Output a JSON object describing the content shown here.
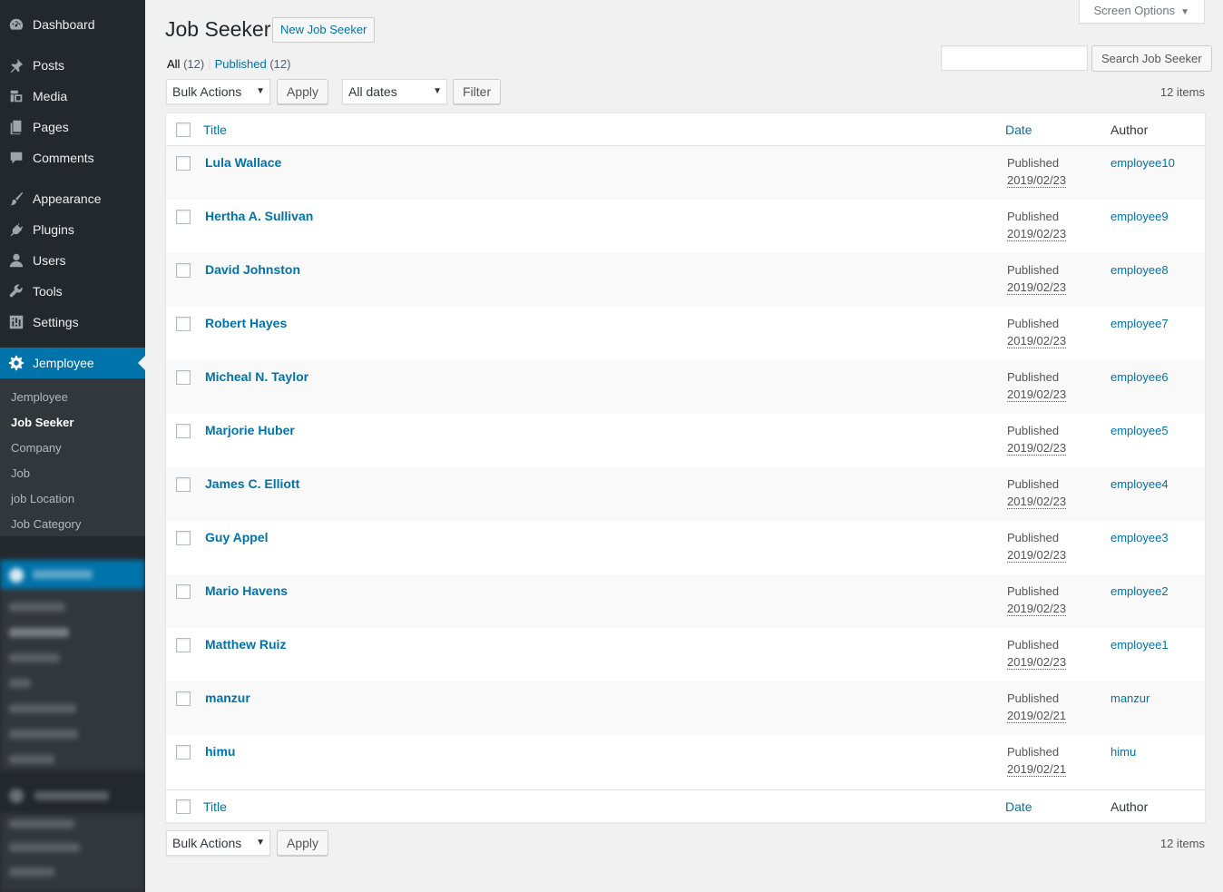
{
  "sidebar": {
    "menu": [
      {
        "label": "Dashboard",
        "icon": "dashboard-icon"
      },
      {
        "label": "Posts",
        "icon": "pin-icon"
      },
      {
        "label": "Media",
        "icon": "media-icon"
      },
      {
        "label": "Pages",
        "icon": "pages-icon"
      },
      {
        "label": "Comments",
        "icon": "comment-icon"
      },
      {
        "label": "Appearance",
        "icon": "brush-icon"
      },
      {
        "label": "Plugins",
        "icon": "plug-icon"
      },
      {
        "label": "Users",
        "icon": "user-icon"
      },
      {
        "label": "Tools",
        "icon": "wrench-icon"
      },
      {
        "label": "Settings",
        "icon": "settings-icon"
      },
      {
        "label": "Jemployee",
        "icon": "gear-icon"
      }
    ],
    "submenu": [
      "Jemployee",
      "Job Seeker",
      "Company",
      "Job",
      "job Location",
      "Job Category"
    ]
  },
  "header": {
    "screen_options": "Screen Options",
    "title": "Job Seeker",
    "new_button": "New Job Seeker"
  },
  "filters": {
    "all_label": "All",
    "all_count": "(12)",
    "published_label": "Published",
    "published_count": "(12)",
    "separator": "|"
  },
  "search": {
    "button": "Search Job Seeker",
    "value": ""
  },
  "toolbar": {
    "bulk_actions": "Bulk Actions",
    "apply": "Apply",
    "all_dates": "All dates",
    "filter": "Filter",
    "items_count": "12 items"
  },
  "table": {
    "columns": {
      "title": "Title",
      "date": "Date",
      "author": "Author"
    },
    "rows": [
      {
        "title": "Lula Wallace",
        "status": "Published",
        "date": "2019/02/23",
        "author": "employee10"
      },
      {
        "title": "Hertha A. Sullivan",
        "status": "Published",
        "date": "2019/02/23",
        "author": "employee9"
      },
      {
        "title": "David Johnston",
        "status": "Published",
        "date": "2019/02/23",
        "author": "employee8"
      },
      {
        "title": "Robert Hayes",
        "status": "Published",
        "date": "2019/02/23",
        "author": "employee7"
      },
      {
        "title": "Micheal N. Taylor",
        "status": "Published",
        "date": "2019/02/23",
        "author": "employee6"
      },
      {
        "title": "Marjorie Huber",
        "status": "Published",
        "date": "2019/02/23",
        "author": "employee5"
      },
      {
        "title": "James C. Elliott",
        "status": "Published",
        "date": "2019/02/23",
        "author": "employee4"
      },
      {
        "title": "Guy Appel",
        "status": "Published",
        "date": "2019/02/23",
        "author": "employee3"
      },
      {
        "title": "Mario Havens",
        "status": "Published",
        "date": "2019/02/23",
        "author": "employee2"
      },
      {
        "title": "Matthew Ruiz",
        "status": "Published",
        "date": "2019/02/23",
        "author": "employee1"
      },
      {
        "title": "manzur",
        "status": "Published",
        "date": "2019/02/21",
        "author": "manzur"
      },
      {
        "title": "himu",
        "status": "Published",
        "date": "2019/02/21",
        "author": "himu"
      }
    ]
  }
}
